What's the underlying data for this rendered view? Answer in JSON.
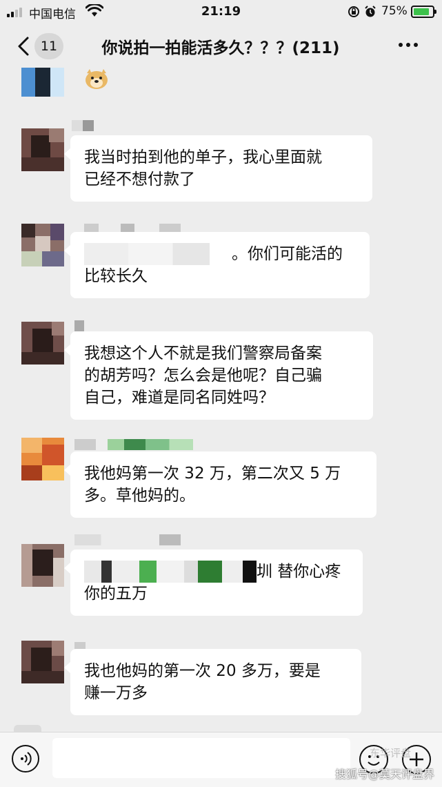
{
  "status_bar": {
    "carrier": "中国电信",
    "time": "21:19",
    "battery": "75%"
  },
  "nav": {
    "unread_count": "11",
    "title": "你说拍一拍能活多久？？？(211)"
  },
  "messages": [
    {
      "text_lines": [
        "我当时拍到他的单子，我心里面就",
        "已经不想付款了"
      ]
    },
    {
      "text_lines": [
        "。你们可能活的",
        "比较长久"
      ]
    },
    {
      "text_lines": [
        "我想这个人不就是我们警察局备案",
        "的胡芳吗？怎么会是他呢？自己骗",
        "自己，难道是同名同姓吗？"
      ]
    },
    {
      "text_lines": [
        "我他妈第一次 32 万，第二次又 5 万",
        "多。草他妈的。"
      ]
    },
    {
      "text_lines": [
        "圳 替你心疼",
        "你的五万"
      ]
    },
    {
      "text_lines": [
        "我也他妈的第一次 20 多万，要是",
        "赚一万多"
      ]
    }
  ],
  "watermark": {
    "text": "搜狐号@莫天评盘界",
    "faded": "东华评盘"
  },
  "colors": {
    "background": "#ededed",
    "bubble": "#ffffff",
    "battery_green": "#3cc14b"
  }
}
